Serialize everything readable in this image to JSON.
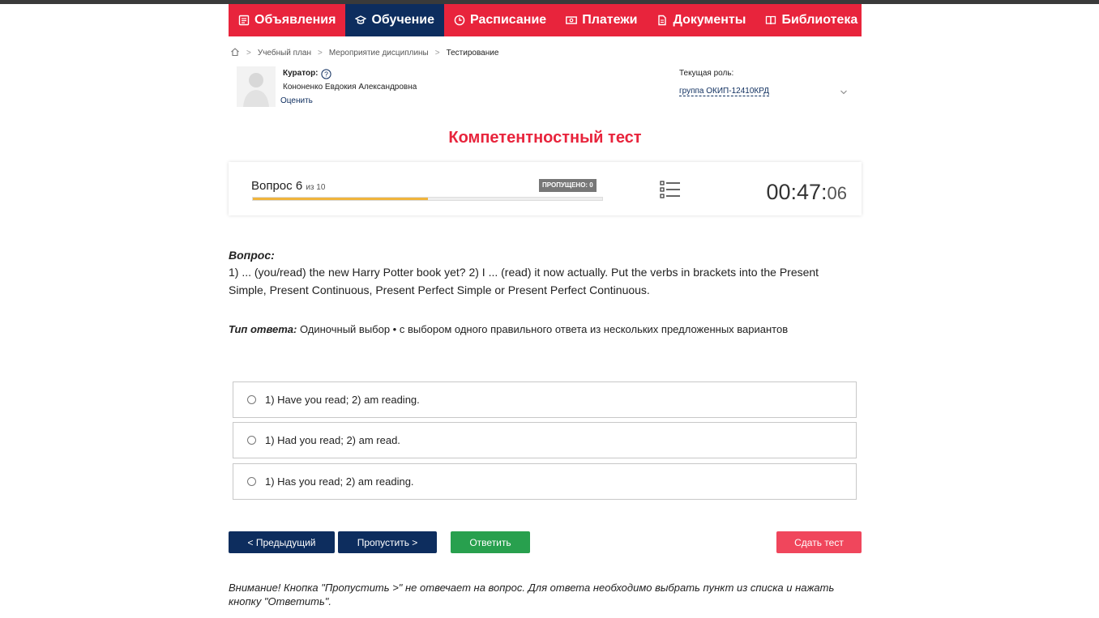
{
  "nav": {
    "items": [
      {
        "label": "Объявления",
        "icon": "news-icon",
        "active": false
      },
      {
        "label": "Обучение",
        "icon": "graduation-cap-icon",
        "active": true
      },
      {
        "label": "Расписание",
        "icon": "clock-icon",
        "active": false
      },
      {
        "label": "Платежи",
        "icon": "money-icon",
        "active": false
      },
      {
        "label": "Документы",
        "icon": "document-icon",
        "active": false
      },
      {
        "label": "Библиотека",
        "icon": "book-icon",
        "active": false
      }
    ],
    "accent": "#e8243c",
    "active_bg": "#0d2d5e"
  },
  "breadcrumb": {
    "items": [
      "Учебный план",
      "Мероприятие дисциплины"
    ],
    "current": "Тестирование"
  },
  "curator": {
    "label": "Куратор:",
    "name": "Кононенко Евдокия Александровна",
    "rate_link": "Оценить"
  },
  "role": {
    "label": "Текущая роль:",
    "value": "группа ОКИП-12410КРД"
  },
  "page_title": "Компетентностный тест",
  "progress": {
    "question_prefix": "Вопрос 6",
    "question_suffix": "из 10",
    "current": 6,
    "total": 10,
    "fill_fraction": 0.5,
    "skipped_badge": "ПРОПУЩЕНО: 0",
    "timer_main": "00:47:",
    "timer_seconds": "06"
  },
  "question": {
    "heading": "Вопрос:",
    "text": "1) ... (you/read) the new Harry Potter book yet? 2) I ... (read) it now actually. Put the verbs in brackets into the Present Simple, Present Continuous, Present Perfect Simple or Present Perfect Continuous.",
    "answer_type_label": "Тип ответа:",
    "answer_type_value": "Одиночный выбор • с выбором одного правильного ответа из нескольких предложенных вариантов"
  },
  "options": [
    "1) Have you read; 2) am reading.",
    "1) Had you read; 2) am read.",
    "1) Has you read; 2) am reading."
  ],
  "buttons": {
    "prev": "< Предыдущий",
    "skip": "Пропустить >",
    "answer": "Ответить",
    "submit": "Сдать тест"
  },
  "note": "Внимание! Кнопка \"Пропустить >\" не отвечает на вопрос. Для ответа необходимо выбрать пункт из списка и нажать кнопку \"Ответить\"."
}
